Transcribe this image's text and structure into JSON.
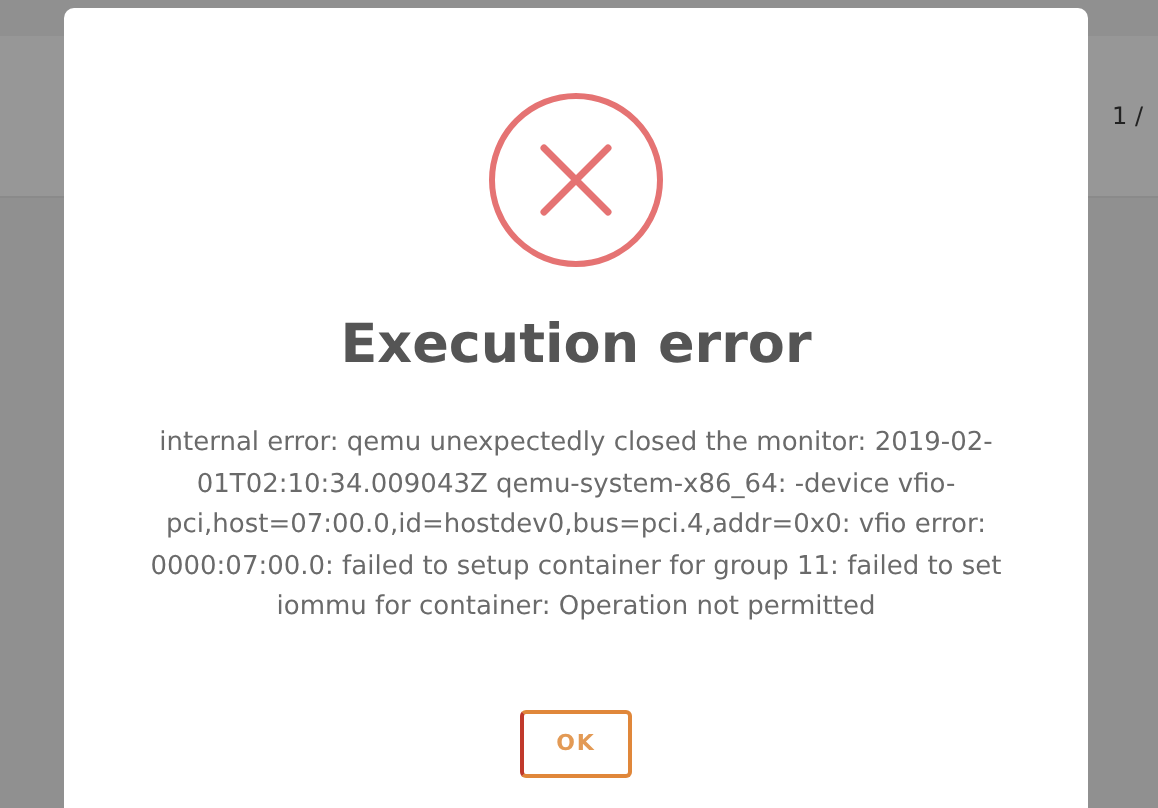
{
  "background": {
    "page_indicator": "1 /"
  },
  "dialog": {
    "title": "Execution error",
    "message": "internal error: qemu unexpectedly closed the monitor: 2019-02-01T02:10:34.009043Z qemu-system-x86_64: -device vfio-pci,host=07:00.0,id=hostdev0,bus=pci.4,addr=0x0: vfio error: 0000:07:00.0: failed to setup container for group 11: failed to set iommu for container: Operation not permitted",
    "buttons": [
      "OK"
    ]
  }
}
